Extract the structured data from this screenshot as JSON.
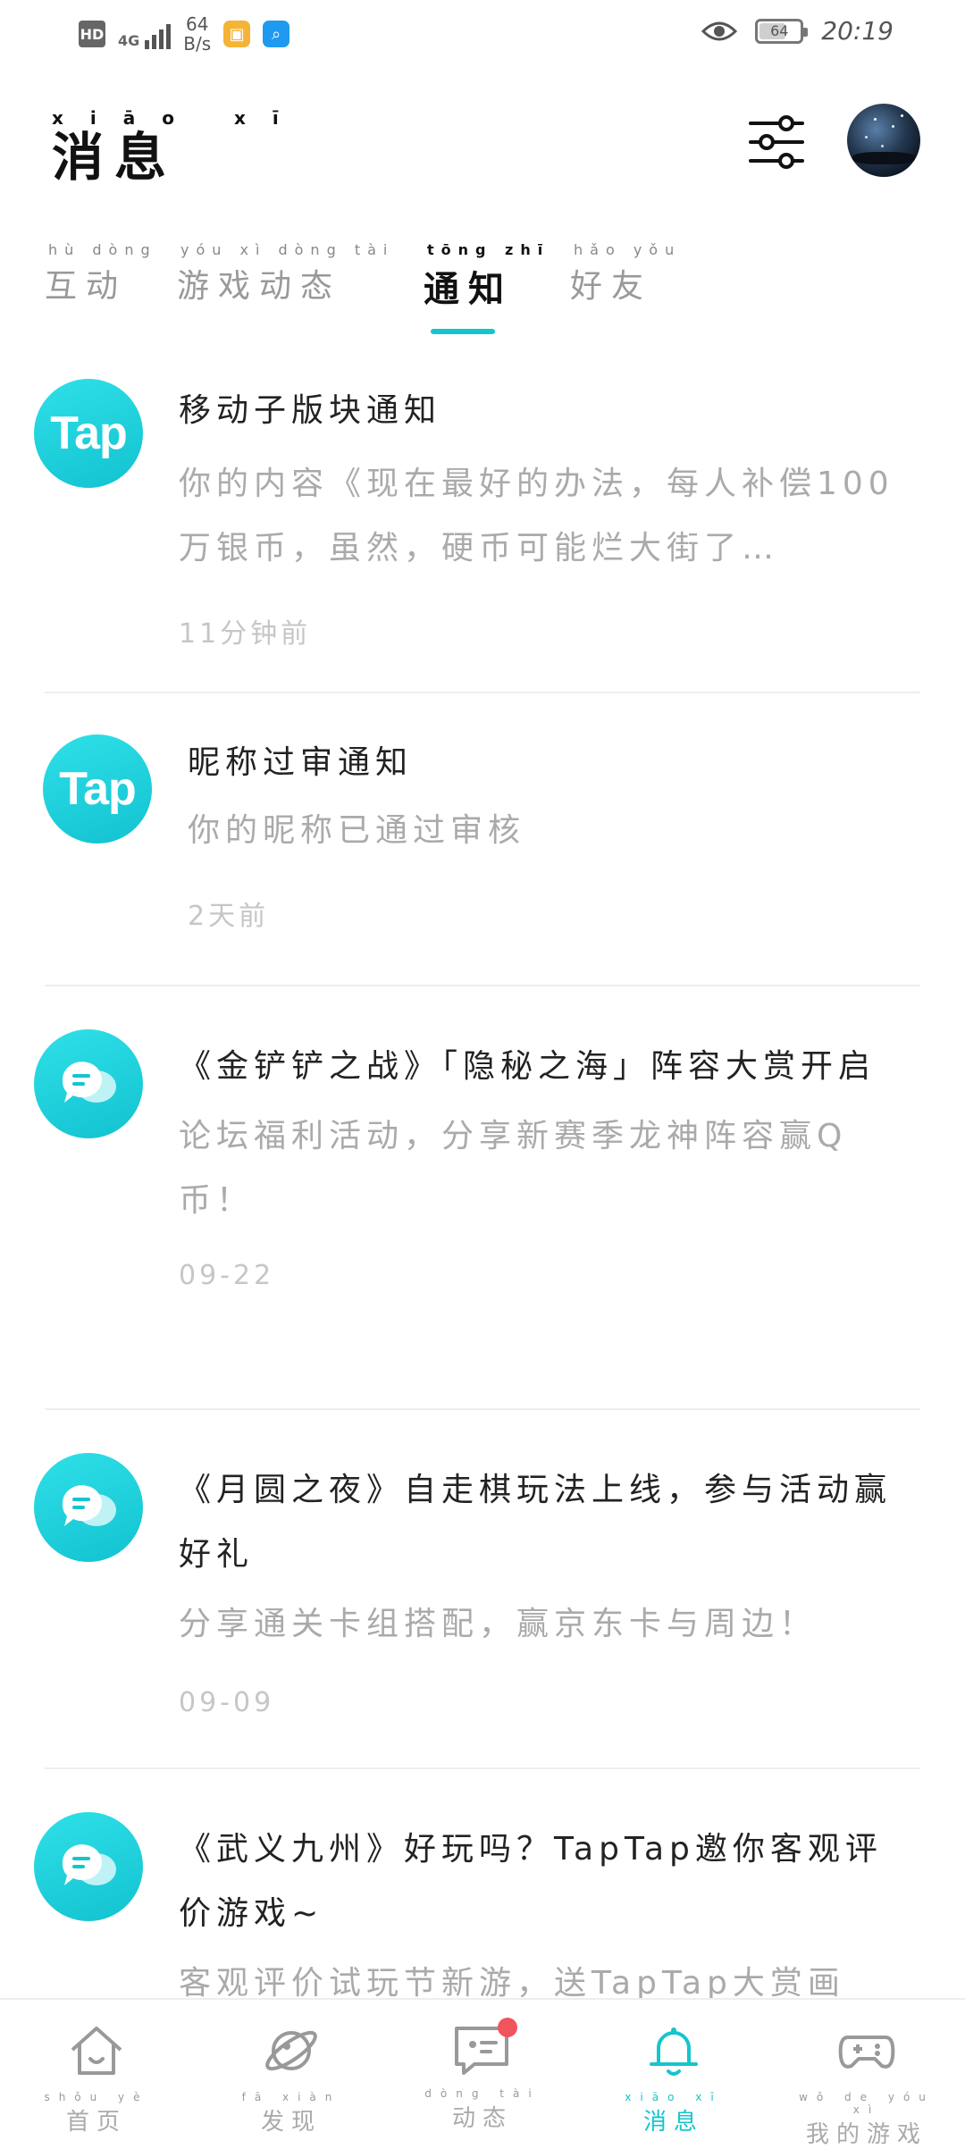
{
  "status_bar": {
    "hd": "HD",
    "network": "4G",
    "speed_value": "64",
    "speed_unit": "B/s",
    "battery": "64",
    "time": "20:19"
  },
  "header": {
    "title_pinyin": "xiāo xī",
    "title": "消息"
  },
  "tabs": [
    {
      "pinyin": "hù dòng",
      "label": "互动"
    },
    {
      "pinyin": "yóu xì dòng tài",
      "label": "游戏动态"
    },
    {
      "pinyin": "tōng zhī",
      "label": "通知"
    },
    {
      "pinyin": "hǎo yǒu",
      "label": "好友"
    }
  ],
  "notifications": [
    {
      "icon": "tap",
      "title": "移动子版块通知",
      "body": "你的内容《现在最好的办法，每人补偿100万银币，虽然，硬币可能烂大街了…",
      "time": "11分钟前"
    },
    {
      "icon": "tap",
      "title": "昵称过审通知",
      "body": "你的昵称已通过审核",
      "time": "2天前"
    },
    {
      "icon": "chat",
      "title": "《金铲铲之战》「隐秘之海」阵容大赏开启",
      "body": "论坛福利活动，分享新赛季龙神阵容赢Q币！",
      "time": "09-22"
    },
    {
      "icon": "chat",
      "title": "《月圆之夜》自走棋玩法上线，参与活动赢好礼",
      "body": "分享通关卡组搭配，赢京东卡与周边！",
      "time": "09-09"
    },
    {
      "icon": "chat",
      "title": "《武义九州》好玩吗？TapTap邀你客观评价游戏~",
      "body": "客观评价试玩节新游，送TapTap大赏画",
      "time": ""
    }
  ],
  "logo_text": "Tap",
  "bottom_nav": [
    {
      "pinyin": "shǒu yè",
      "label": "首页",
      "icon": "home-icon"
    },
    {
      "pinyin": "fā xiàn",
      "label": "发现",
      "icon": "planet-icon"
    },
    {
      "pinyin": "dòng tài",
      "label": "动态",
      "icon": "chat-icon"
    },
    {
      "pinyin": "xiāo xī",
      "label": "消息",
      "icon": "bell-icon"
    },
    {
      "pinyin": "wǒ de yóu xì",
      "label": "我的游戏",
      "icon": "gamepad-icon"
    }
  ],
  "colors": {
    "accent": "#15c5ce",
    "badge": "#f2545b"
  }
}
